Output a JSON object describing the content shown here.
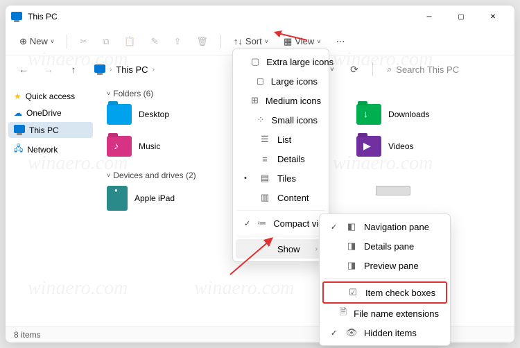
{
  "window": {
    "title": "This PC"
  },
  "toolbar": {
    "new": "New",
    "sort": "Sort",
    "view": "View"
  },
  "address": {
    "location": "This PC",
    "search_placeholder": "Search This PC"
  },
  "sidebar": {
    "items": [
      {
        "label": "Quick access",
        "icon": "star",
        "color": "#f5c518"
      },
      {
        "label": "OneDrive",
        "icon": "cloud",
        "color": "#0078d4"
      },
      {
        "label": "This PC",
        "icon": "pc",
        "color": "#0078d4",
        "active": true
      },
      {
        "label": "Network",
        "icon": "network",
        "color": "#0078d4"
      }
    ]
  },
  "sections": {
    "folders": {
      "header": "Folders (6)"
    },
    "devices": {
      "header": "Devices and drives (2)"
    }
  },
  "folders": [
    {
      "label": "Desktop",
      "color": "#00a2ed"
    },
    {
      "label": "Downloads",
      "color": "#00b050"
    },
    {
      "label": "Music",
      "color": "#d63384"
    },
    {
      "label": "Videos",
      "color": "#7030a0"
    }
  ],
  "devices": [
    {
      "label": "Apple iPad"
    }
  ],
  "view_menu": {
    "items": [
      {
        "label": "Extra large icons",
        "icon": "grid-lg"
      },
      {
        "label": "Large icons",
        "icon": "grid-md"
      },
      {
        "label": "Medium icons",
        "icon": "grid-sm"
      },
      {
        "label": "Small icons",
        "icon": "grid-xs"
      },
      {
        "label": "List",
        "icon": "list"
      },
      {
        "label": "Details",
        "icon": "details"
      },
      {
        "label": "Tiles",
        "icon": "tiles",
        "checked": true
      },
      {
        "label": "Content",
        "icon": "content"
      }
    ],
    "compact": "Compact view",
    "show": "Show"
  },
  "show_menu": {
    "items": [
      {
        "label": "Navigation pane",
        "checked": true
      },
      {
        "label": "Details pane"
      },
      {
        "label": "Preview pane"
      },
      {
        "label": "Item check boxes",
        "highlight": true
      },
      {
        "label": "File name extensions"
      },
      {
        "label": "Hidden items",
        "checked": true
      }
    ]
  },
  "status": {
    "text": "8 items"
  },
  "watermark": "winaero.com"
}
